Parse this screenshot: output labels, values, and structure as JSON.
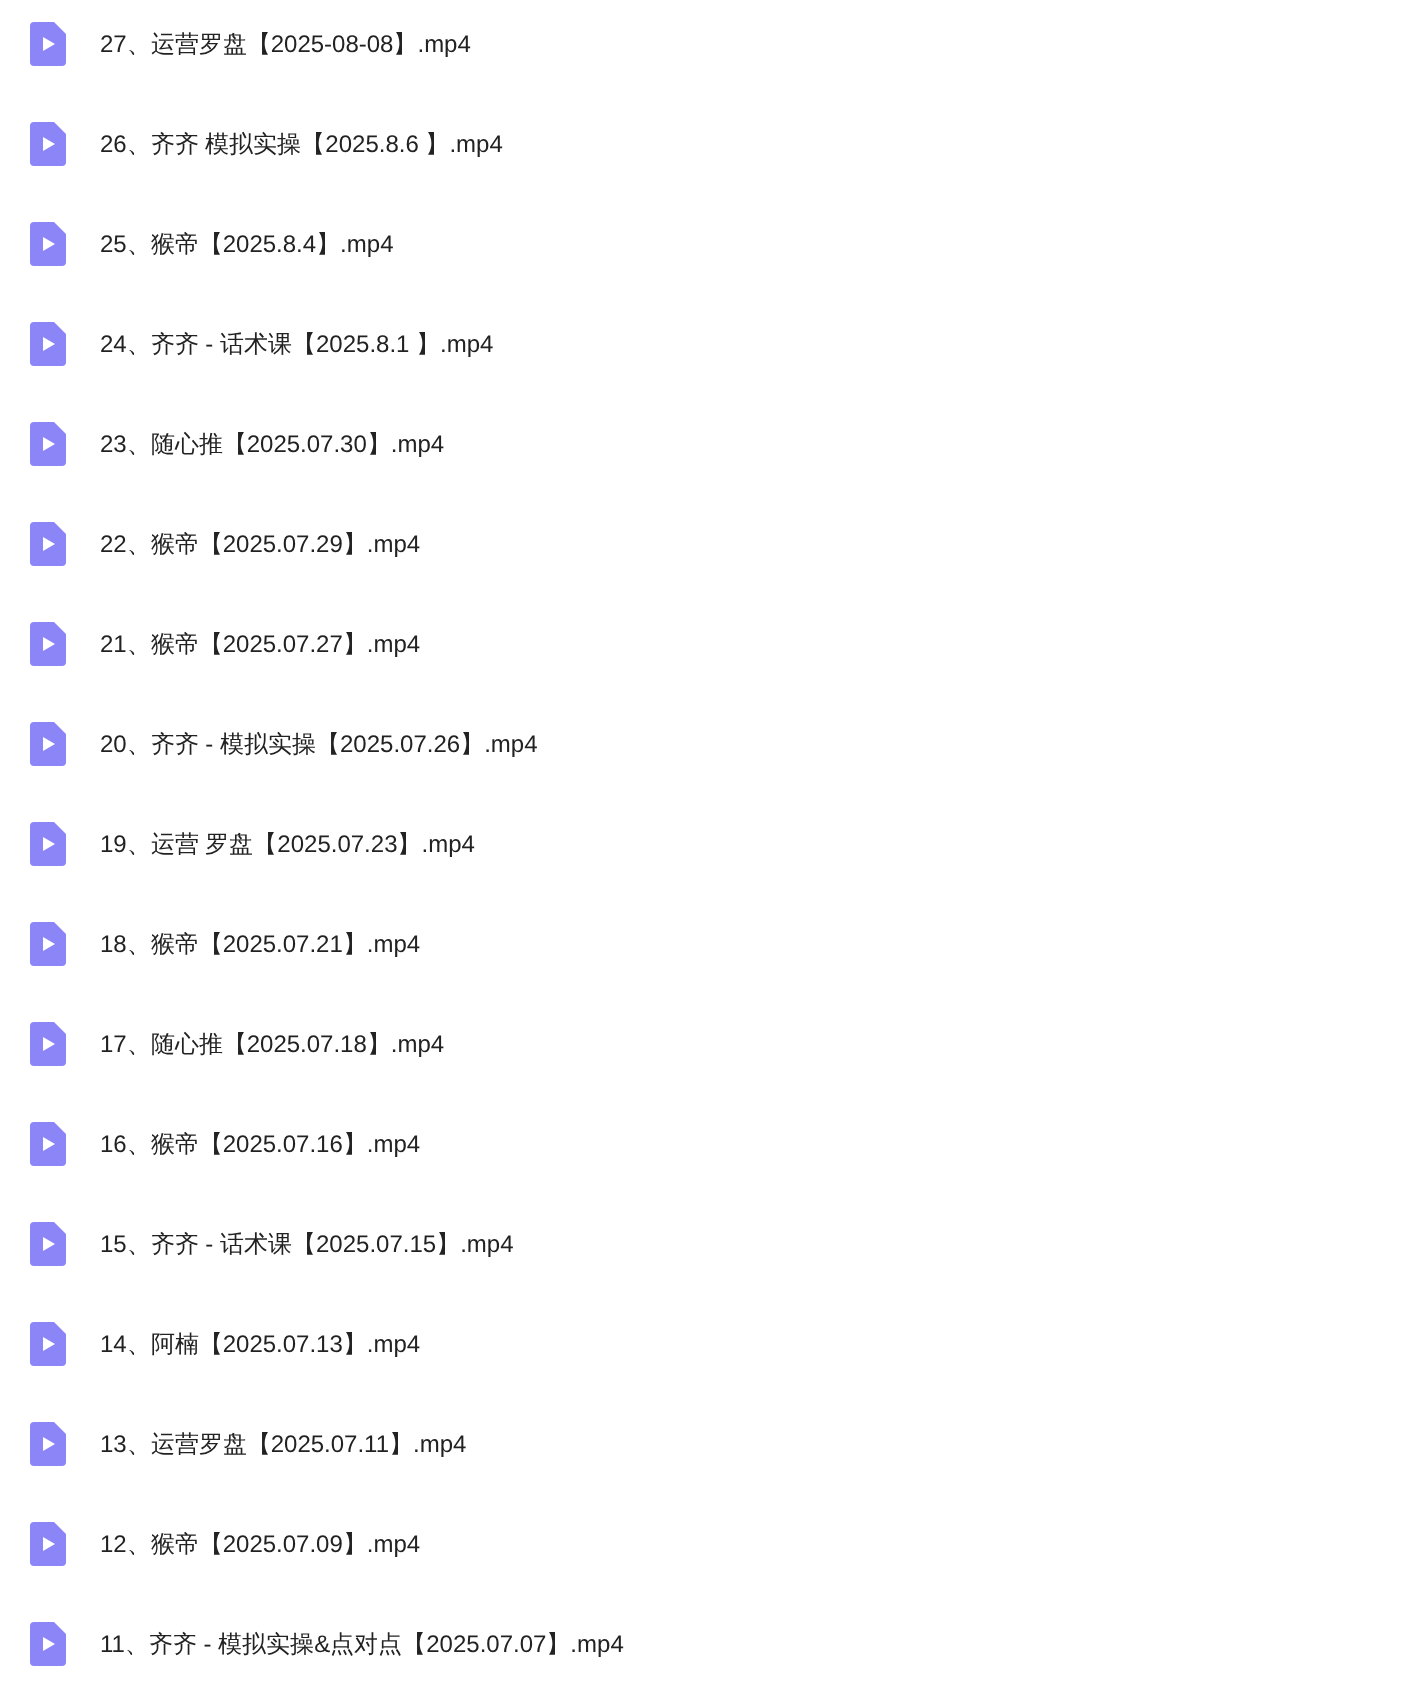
{
  "files": [
    {
      "name": "27、运营罗盘【2025-08-08】.mp4"
    },
    {
      "name": "26、齐齐 模拟实操【2025.8.6 】.mp4"
    },
    {
      "name": "25、猴帝【2025.8.4】.mp4"
    },
    {
      "name": "24、齐齐 - 话术课【2025.8.1 】.mp4"
    },
    {
      "name": "23、随心推【2025.07.30】.mp4"
    },
    {
      "name": "22、猴帝【2025.07.29】.mp4"
    },
    {
      "name": "21、猴帝【2025.07.27】.mp4"
    },
    {
      "name": "20、齐齐 - 模拟实操【2025.07.26】.mp4"
    },
    {
      "name": "19、运营 罗盘【2025.07.23】.mp4"
    },
    {
      "name": "18、猴帝【2025.07.21】.mp4"
    },
    {
      "name": "17、随心推【2025.07.18】.mp4"
    },
    {
      "name": "16、猴帝【2025.07.16】.mp4"
    },
    {
      "name": "15、齐齐 - 话术课【2025.07.15】.mp4"
    },
    {
      "name": "14、阿楠【2025.07.13】.mp4"
    },
    {
      "name": "13、运营罗盘【2025.07.11】.mp4"
    },
    {
      "name": "12、猴帝【2025.07.09】.mp4"
    },
    {
      "name": "11、齐齐 - 模拟实操&点对点【2025.07.07】.mp4"
    }
  ]
}
